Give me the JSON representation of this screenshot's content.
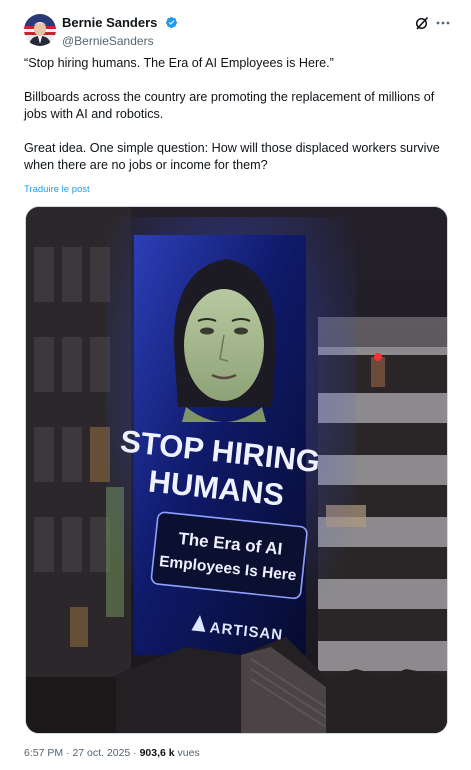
{
  "author": {
    "display_name": "Bernie Sanders",
    "handle": "@BernieSanders",
    "verified": true
  },
  "icons": {
    "verified": "verified-badge-icon",
    "grok": "grok-icon",
    "more": "more-options-icon"
  },
  "tweet": {
    "paragraphs": [
      "“Stop hiring humans. The Era of AI Employees is Here.”",
      "Billboards across the country are promoting the replacement of millions of jobs with AI and robotics.",
      "Great idea. One simple question: How will those displaced workers survive when there are no jobs or income for them?"
    ],
    "translate_label": "Traduire le post"
  },
  "media": {
    "billboard": {
      "headline_line1": "STOP HIRING",
      "headline_line2": "HUMANS",
      "sub_line1": "The Era of AI",
      "sub_line2": "Employees Is Here",
      "brand": "ARTISAN"
    }
  },
  "meta": {
    "time": "6:57 PM",
    "separator": " · ",
    "date": "27 oct. 2025",
    "separator2": " · ",
    "views_count": "903,6 k",
    "views_label": " vues"
  },
  "colors": {
    "link": "#1d9bf0",
    "verified": "#1d9bf0",
    "secondary_text": "#536471"
  }
}
